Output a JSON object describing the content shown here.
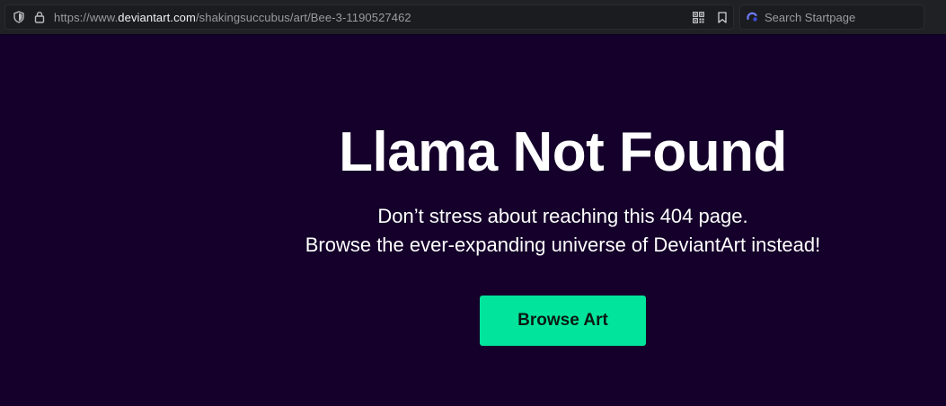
{
  "browser": {
    "url_prefix": "https://www.",
    "url_domain": "deviantart.com",
    "url_path": "/shakingsuccubus/art/Bee-3-1190527462",
    "search_placeholder": "Search Startpage",
    "icons": [
      "shield-icon",
      "lock-icon",
      "qr-code-icon",
      "bookmark-icon",
      "search-engine-icon"
    ]
  },
  "page": {
    "title": "Llama Not Found",
    "line1": "Don’t stress about reaching this 404 page.",
    "line2": "Browse the ever-expanding universe of DeviantArt instead!",
    "button_label": "Browse Art"
  },
  "colors": {
    "background": "#14002a",
    "button": "#00e59b",
    "text": "#ffffff"
  }
}
